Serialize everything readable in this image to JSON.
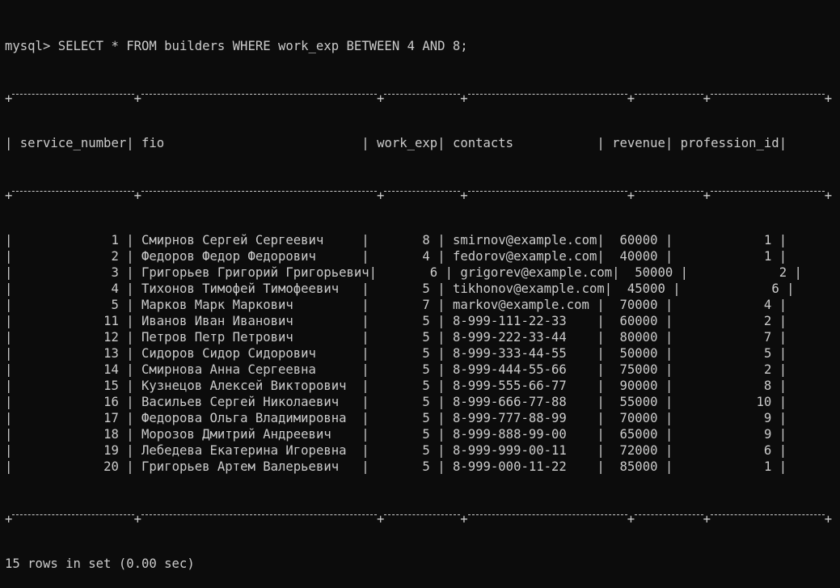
{
  "prompt": "mysql>",
  "query": "SELECT * FROM builders WHERE work_exp BETWEEN 4 AND 8;",
  "columns": [
    {
      "name": "service_number",
      "width": 16,
      "align": "right"
    },
    {
      "name": "fio",
      "width": 31,
      "align": "left"
    },
    {
      "name": "work_exp",
      "width": 10,
      "align": "right"
    },
    {
      "name": "contacts",
      "width": 21,
      "align": "left"
    },
    {
      "name": "revenue",
      "width": 9,
      "align": "right"
    },
    {
      "name": "profession_id",
      "width": 15,
      "align": "right"
    }
  ],
  "rows": [
    [
      "1",
      "Смирнов Сергей Сергеевич",
      "8",
      "smirnov@example.com",
      "60000",
      "1"
    ],
    [
      "2",
      "Федоров Федор Федорович",
      "4",
      "fedorov@example.com",
      "40000",
      "1"
    ],
    [
      "3",
      "Григорьев Григорий Григорьевич",
      "6",
      "grigorev@example.com",
      "50000",
      "2"
    ],
    [
      "4",
      "Тихонов Тимофей Тимофеевич",
      "5",
      "tikhonov@example.com",
      "45000",
      "6"
    ],
    [
      "5",
      "Марков Марк Маркович",
      "7",
      "markov@example.com",
      "70000",
      "4"
    ],
    [
      "11",
      "Иванов Иван Иванович",
      "5",
      "8-999-111-22-33",
      "60000",
      "2"
    ],
    [
      "12",
      "Петров Петр Петрович",
      "5",
      "8-999-222-33-44",
      "80000",
      "7"
    ],
    [
      "13",
      "Сидоров Сидор Сидорович",
      "5",
      "8-999-333-44-55",
      "50000",
      "5"
    ],
    [
      "14",
      "Смирнова Анна Сергеевна",
      "5",
      "8-999-444-55-66",
      "75000",
      "2"
    ],
    [
      "15",
      "Кузнецов Алексей Викторович",
      "5",
      "8-999-555-66-77",
      "90000",
      "8"
    ],
    [
      "16",
      "Васильев Сергей Николаевич",
      "5",
      "8-999-666-77-88",
      "55000",
      "10"
    ],
    [
      "17",
      "Федорова Ольга Владимировна",
      "5",
      "8-999-777-88-99",
      "70000",
      "9"
    ],
    [
      "18",
      "Морозов Дмитрий Андреевич",
      "5",
      "8-999-888-99-00",
      "65000",
      "9"
    ],
    [
      "19",
      "Лебедева Екатерина Игоревна",
      "5",
      "8-999-999-00-11",
      "72000",
      "6"
    ],
    [
      "20",
      "Григорьев Артем Валерьевич",
      "5",
      "8-999-000-11-22",
      "85000",
      "1"
    ]
  ],
  "footer": "15 rows in set (0.00 sec)",
  "colors": {
    "background": "#0c0c0c",
    "text": "#cccccc"
  }
}
